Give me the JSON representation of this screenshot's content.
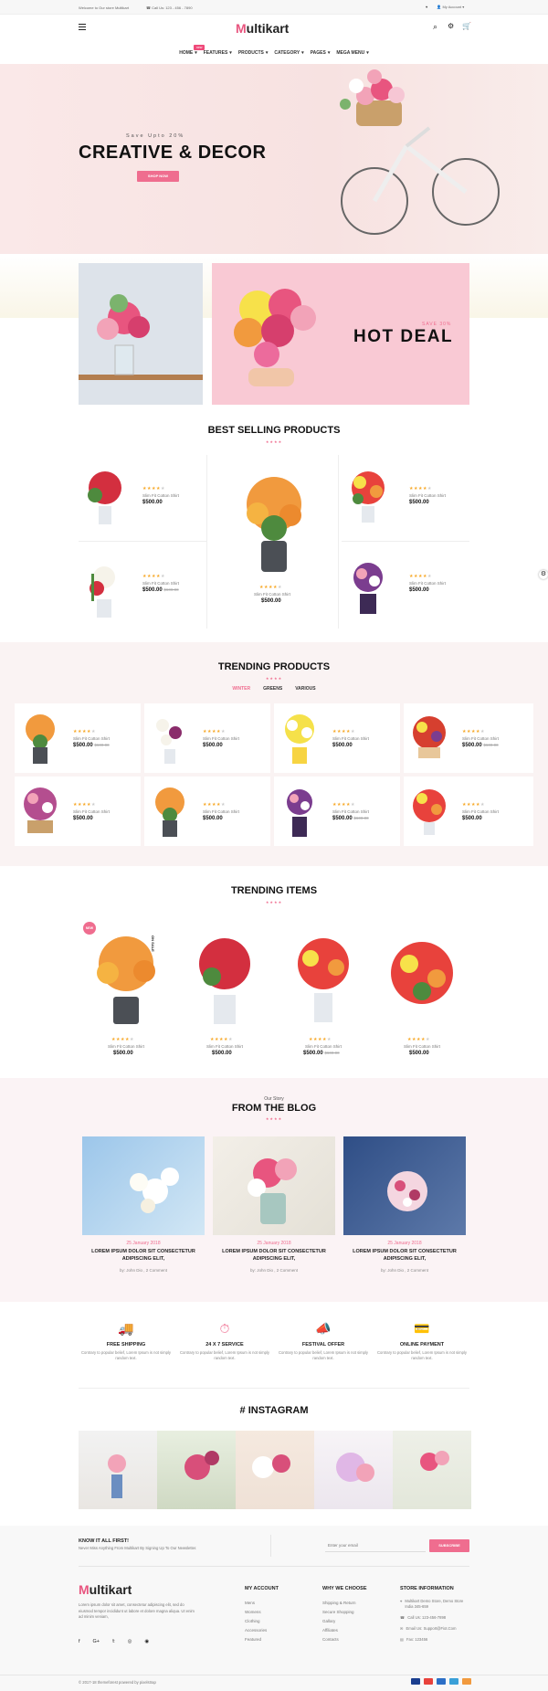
{
  "topbar": {
    "welcome": "Welcome to Our store Multikart",
    "phone": "Call Us: 123 - 456 - 7890",
    "account": "My Account"
  },
  "header": {
    "logo_initial": "M",
    "logo_rest": "ultikart"
  },
  "nav": {
    "items": [
      {
        "label": "HOME"
      },
      {
        "label": "FEATURES"
      },
      {
        "label": "PRODUCTS"
      },
      {
        "label": "CATEGORY"
      },
      {
        "label": "PAGES"
      },
      {
        "label": "MEGA MENU"
      }
    ],
    "new_badge": "new"
  },
  "hero": {
    "subtitle": "Save Upto 20%",
    "title": "CREATIVE & DECOR",
    "button": "SHOP NOW"
  },
  "promo": {
    "save": "SAVE 30%",
    "title": "HOT DEAL"
  },
  "best_selling": {
    "title": "BEST SELLING PRODUCTS",
    "products": [
      {
        "name": "Slim Fit Cotton Shirt",
        "price": "$500.00",
        "old": ""
      },
      {
        "name": "Slim Fit Cotton Shirt",
        "price": "$500.00",
        "old": ""
      },
      {
        "name": "Slim Fit Cotton Shirt",
        "price": "$500.00",
        "old": "$600.00"
      },
      {
        "name": "Slim Fit Cotton Shirt",
        "price": "$500.00",
        "old": ""
      },
      {
        "name": "Slim Fit Cotton Shirt",
        "price": "$500.00",
        "old": ""
      }
    ]
  },
  "trending_products": {
    "title": "TRENDING PRODUCTS",
    "tabs": [
      {
        "label": "WINTER"
      },
      {
        "label": "GREENS"
      },
      {
        "label": "VARIOUS"
      }
    ],
    "products": [
      {
        "name": "Slim Fit Cotton Shirt",
        "price": "$500.00",
        "old": "$600.00"
      },
      {
        "name": "Slim Fit Cotton Shirt",
        "price": "$500.00",
        "old": ""
      },
      {
        "name": "Slim Fit Cotton Shirt",
        "price": "$500.00",
        "old": ""
      },
      {
        "name": "Slim Fit Cotton Shirt",
        "price": "$500.00",
        "old": "$600.00"
      },
      {
        "name": "Slim Fit Cotton Shirt",
        "price": "$500.00",
        "old": ""
      },
      {
        "name": "Slim Fit Cotton Shirt",
        "price": "$500.00",
        "old": ""
      },
      {
        "name": "Slim Fit Cotton Shirt",
        "price": "$500.00",
        "old": "$600.00"
      },
      {
        "name": "Slim Fit Cotton Shirt",
        "price": "$500.00",
        "old": ""
      }
    ]
  },
  "trending_items": {
    "title": "TRENDING ITEMS",
    "new_badge": "NEW",
    "sale_label": "ON SALE",
    "items": [
      {
        "name": "Slim Fit Cotton Shirt",
        "price": "$500.00",
        "old": ""
      },
      {
        "name": "Slim Fit Cotton Shirt",
        "price": "$500.00",
        "old": ""
      },
      {
        "name": "Slim Fit Cotton Shirt",
        "price": "$500.00",
        "old": "$600.00"
      },
      {
        "name": "Slim Fit Cotton Shirt",
        "price": "$500.00",
        "old": ""
      }
    ]
  },
  "blog": {
    "kicker": "Our Story",
    "title": "FROM THE BLOG",
    "posts": [
      {
        "date": "25 January 2018",
        "title": "LOREM IPSUM DOLOR SIT CONSECTETUR ADIPISCING ELIT,",
        "meta": "by: John Dio , 2 Comment"
      },
      {
        "date": "25 January 2018",
        "title": "LOREM IPSUM DOLOR SIT CONSECTETUR ADIPISCING ELIT,",
        "meta": "by: John Dio , 2 Comment"
      },
      {
        "date": "25 January 2018",
        "title": "LOREM IPSUM DOLOR SIT CONSECTETUR ADIPISCING ELIT,",
        "meta": "by: John Dio , 2 Comment"
      }
    ]
  },
  "services": [
    {
      "title": "FREE SHIPPING",
      "text": "Contrary to popular belief, Lorem Ipsum is not simply random text."
    },
    {
      "title": "24 X 7 SERVICE",
      "text": "Contrary to popular belief, Lorem Ipsum is not simply random text."
    },
    {
      "title": "FESTIVAL OFFER",
      "text": "Contrary to popular belief, Lorem Ipsum is not simply random text."
    },
    {
      "title": "ONLINE PAYMENT",
      "text": "Contrary to popular belief, Lorem Ipsum is not simply random text."
    }
  ],
  "instagram": {
    "title": "# INSTAGRAM"
  },
  "newsletter": {
    "title": "KNOW IT ALL FIRST!",
    "text": "Never Miss Anything From Multikart By Signing Up To Our Newsletter.",
    "placeholder": "Enter your email",
    "button": "SUBSCRIBE"
  },
  "footer": {
    "about": "Lorem ipsum dolor sit amet, consectetur adipiscing elit, sed do eiusmod tempor incididunt ut labore et dolore magna aliqua. Ut enim ad minim veniam,",
    "my_account": {
      "title": "MY ACCOUNT",
      "links": [
        "Mens",
        "Womens",
        "Clothing",
        "Accessories",
        "Featured"
      ]
    },
    "why": {
      "title": "WHY WE CHOOSE",
      "links": [
        "Shipping & Return",
        "Secure Shopping",
        "Gallary",
        "Affiliates",
        "Contacts"
      ]
    },
    "store": {
      "title": "STORE INFORMATION",
      "address": "Multikart Demo Store, Demo Store India 345-659",
      "call": "Call Us: 123-456-7898",
      "email": "Email Us: Support@Fiot.Com",
      "fax": "Fax: 123456"
    },
    "copyright": "© 2017-18 themeforest powered by pixelstrap"
  },
  "colors": {
    "accent": "#ef6d8f",
    "star": "#f7a928"
  }
}
